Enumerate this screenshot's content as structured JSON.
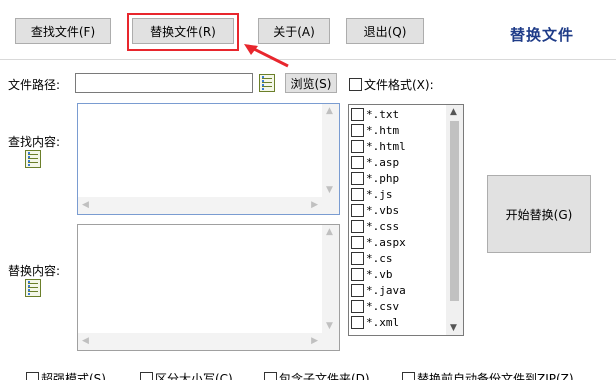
{
  "toolbar": {
    "find_btn": "查找文件(F)",
    "replace_btn": "替换文件(R)",
    "about_btn": "关于(A)",
    "exit_btn": "退出(Q)",
    "app_title": "替换文件"
  },
  "colors": {
    "highlight": "#e8262d",
    "title": "#1f3c88"
  },
  "path": {
    "label": "文件路径:",
    "value": "",
    "browse_btn": "浏览(S)",
    "file_format_label": "文件格式(X):"
  },
  "find": {
    "label": "查找内容:"
  },
  "replace": {
    "label": "替换内容:"
  },
  "file_types": [
    "*.txt",
    "*.htm",
    "*.html",
    "*.asp",
    "*.php",
    "*.js",
    "*.vbs",
    "*.css",
    "*.aspx",
    "*.cs",
    "*.vb",
    "*.java",
    "*.csv",
    "*.xml"
  ],
  "start_btn": "开始替换(G)",
  "options": [
    "超强模式(S)",
    "区分大小写(C)",
    "包含子文件夹(D)",
    "替换前自动备份文件到ZIP(Z)"
  ]
}
